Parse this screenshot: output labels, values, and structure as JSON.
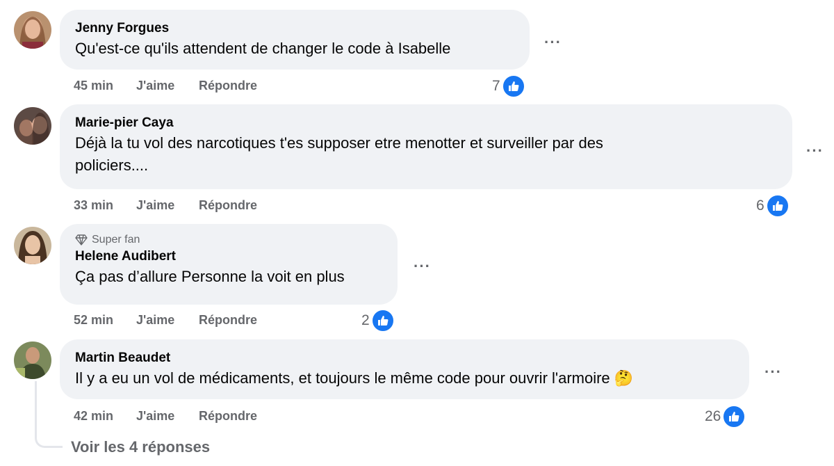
{
  "comments": [
    {
      "author": "Jenny Forgues",
      "text": "Qu'est-ce qu'ils attendent de changer le code à Isabelle",
      "time": "45 min",
      "like_label": "J'aime",
      "reply_label": "Répondre",
      "reactions": "7",
      "options": "···"
    },
    {
      "author": "Marie-pier Caya",
      "text_line1": "Déjà la tu vol des narcotiques t'es supposer etre menotter et surveiller par des",
      "text_line2": "policiers....",
      "time": "33 min",
      "like_label": "J'aime",
      "reply_label": "Répondre",
      "reactions": "6",
      "options": "···"
    },
    {
      "badge": "Super fan",
      "author": "Helene Audibert",
      "text": "Ça pas d’allure Personne la voit en plus",
      "time": "52 min",
      "like_label": "J'aime",
      "reply_label": "Répondre",
      "reactions": "2",
      "options": "···"
    },
    {
      "author": "Martin Beaudet",
      "text": "Il y a eu un vol de médicaments, et toujours le même code pour ouvrir l'armoire",
      "emoji": "🤔",
      "time": "42 min",
      "like_label": "J'aime",
      "reply_label": "Répondre",
      "reactions": "26",
      "options": "···"
    }
  ],
  "view_replies": "Voir les 4 réponses",
  "colors": {
    "like_blue": "#1877f2",
    "bubble": "#f0f2f5",
    "muted": "#65676b"
  }
}
